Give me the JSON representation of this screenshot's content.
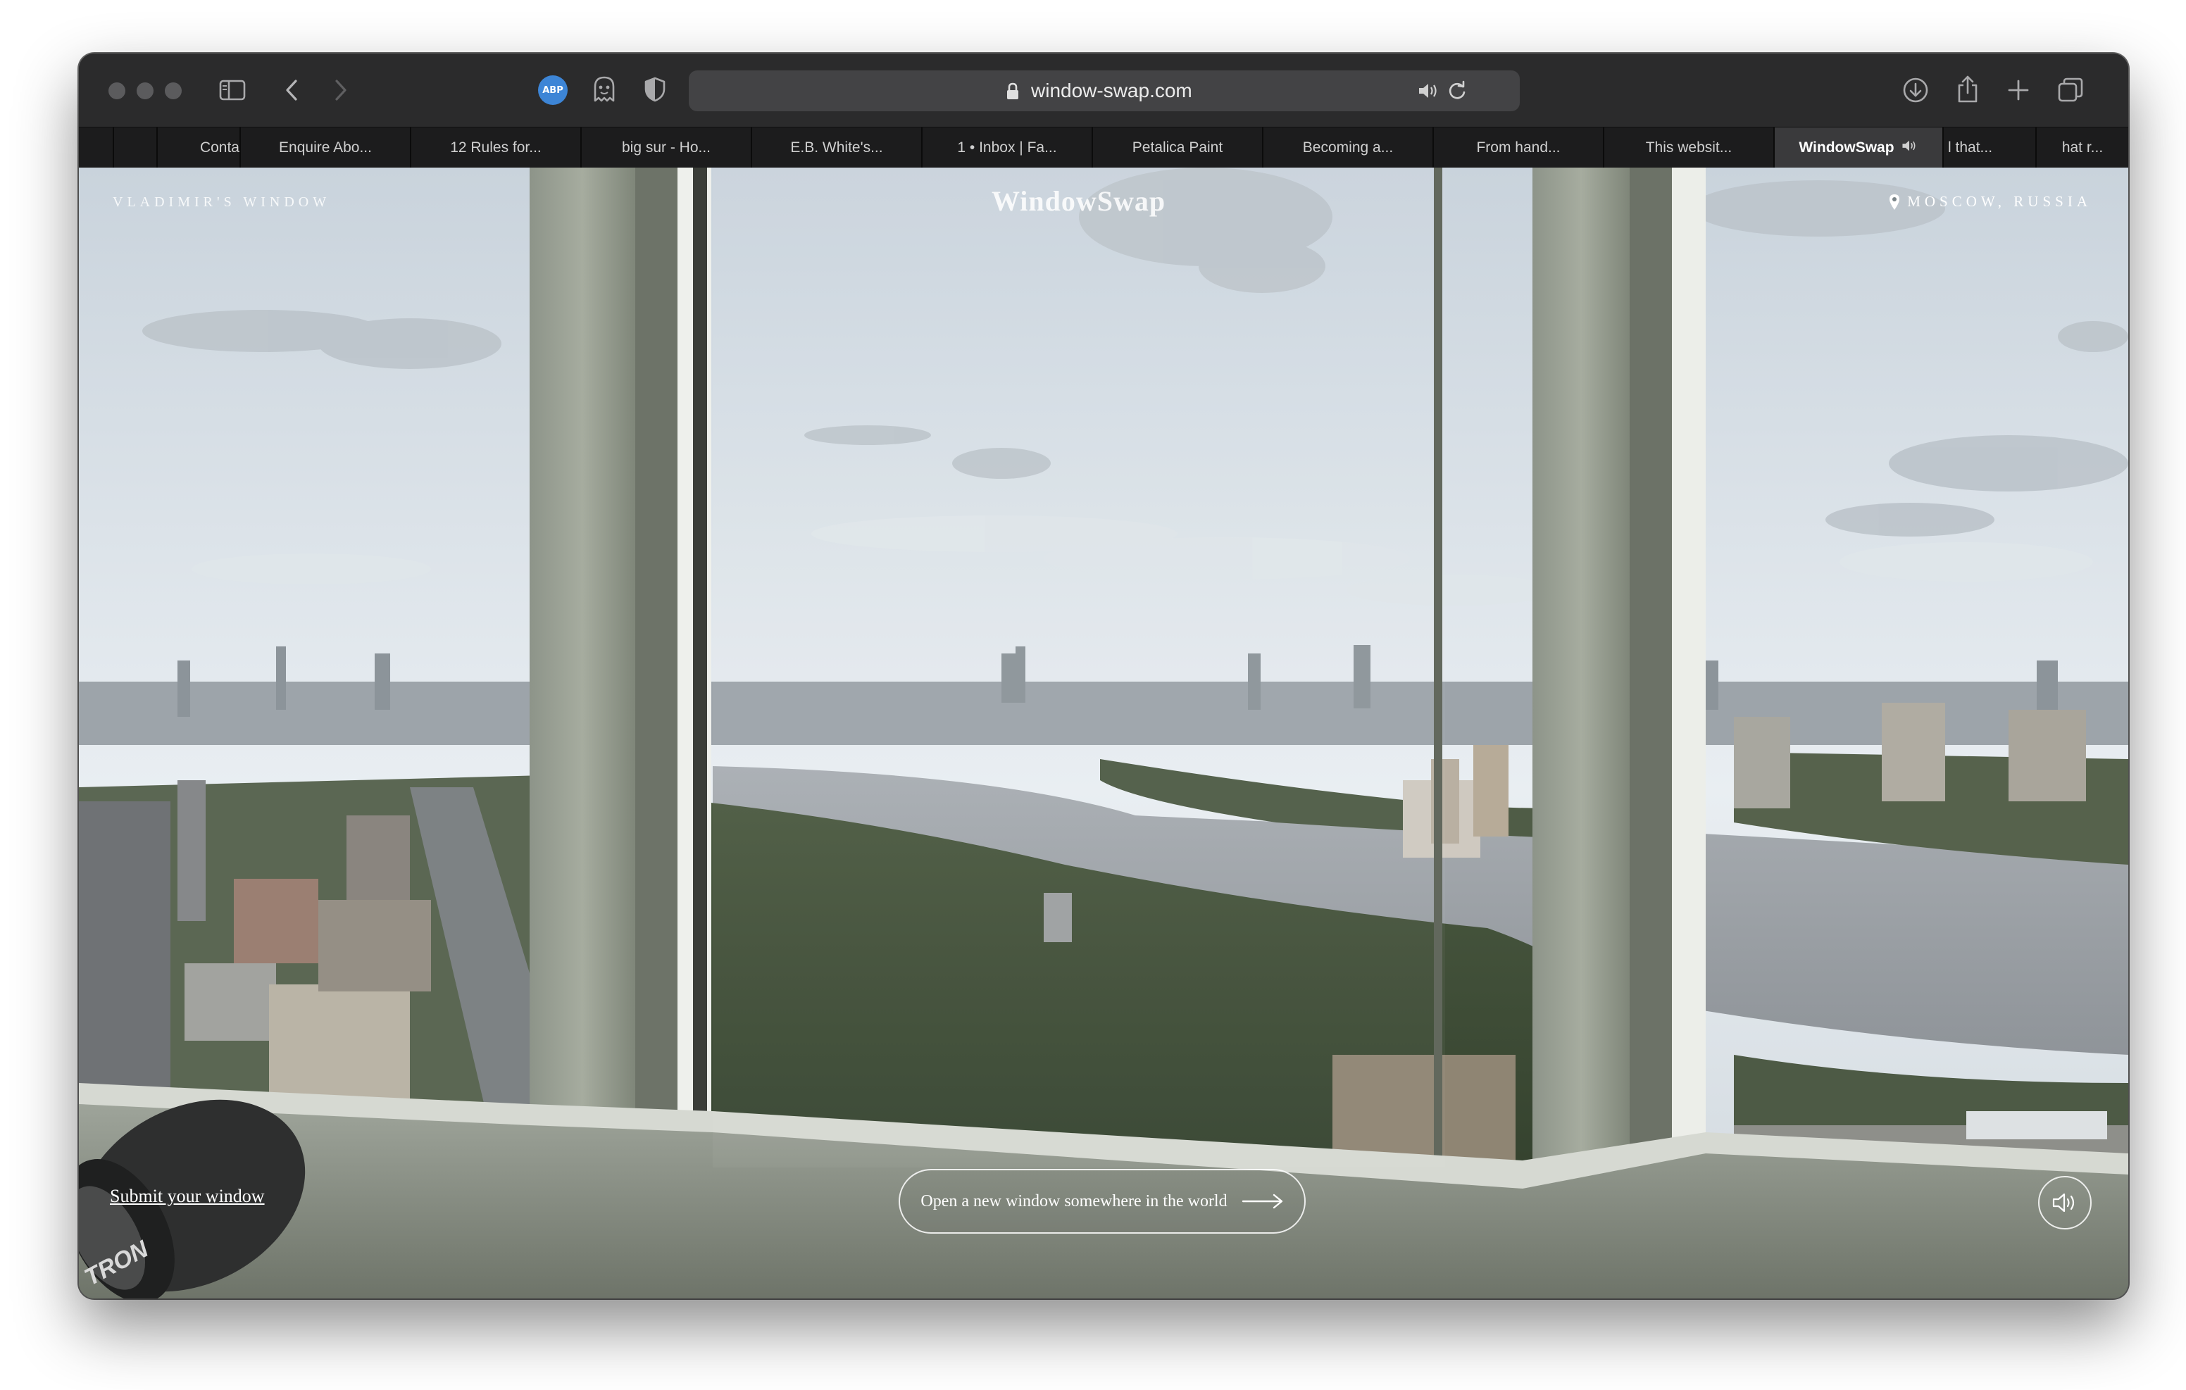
{
  "browser": {
    "url": "window-swap.com",
    "abp_label": "ABP",
    "tabs": [
      {
        "label": ""
      },
      {
        "label": "Conta"
      },
      {
        "label": "Enquire Abo..."
      },
      {
        "label": "12 Rules for..."
      },
      {
        "label": "big sur - Ho..."
      },
      {
        "label": "E.B. White's..."
      },
      {
        "label": "1 • Inbox | Fa..."
      },
      {
        "label": "Petalica Paint"
      },
      {
        "label": "Becoming a..."
      },
      {
        "label": "From hand..."
      },
      {
        "label": "This websit..."
      },
      {
        "label": "WindowSwap",
        "active": true
      },
      {
        "label": "l that..."
      },
      {
        "label": "hat r..."
      }
    ]
  },
  "page": {
    "window_owner": "VLADIMIR'S WINDOW",
    "brand": "WindowSwap",
    "location": "MOSCOW, RUSSIA",
    "submit_link": "Submit your window",
    "open_button": "Open a new window somewhere in the world",
    "binocular_text": "TRON"
  },
  "icons": {
    "sidebar": "sidebar-icon",
    "back": "chevron-left-icon",
    "forward": "chevron-right-icon",
    "ghostery": "ghost-icon",
    "privacy": "shield-icon",
    "lock": "lock-icon",
    "speaker": "speaker-icon",
    "reload": "reload-icon",
    "download": "download-icon",
    "share": "share-icon",
    "new_tab": "plus-icon",
    "tab_overview": "tabs-icon",
    "location_pin": "pin-icon",
    "arrow": "arrow-right-icon",
    "sound": "sound-icon"
  },
  "colors": {
    "toolbar_bg": "#2b2b2c",
    "tabbar_bg": "#1c1c1d",
    "active_tab_bg": "#3a3a3c",
    "abp_blue": "#3d85d6"
  }
}
